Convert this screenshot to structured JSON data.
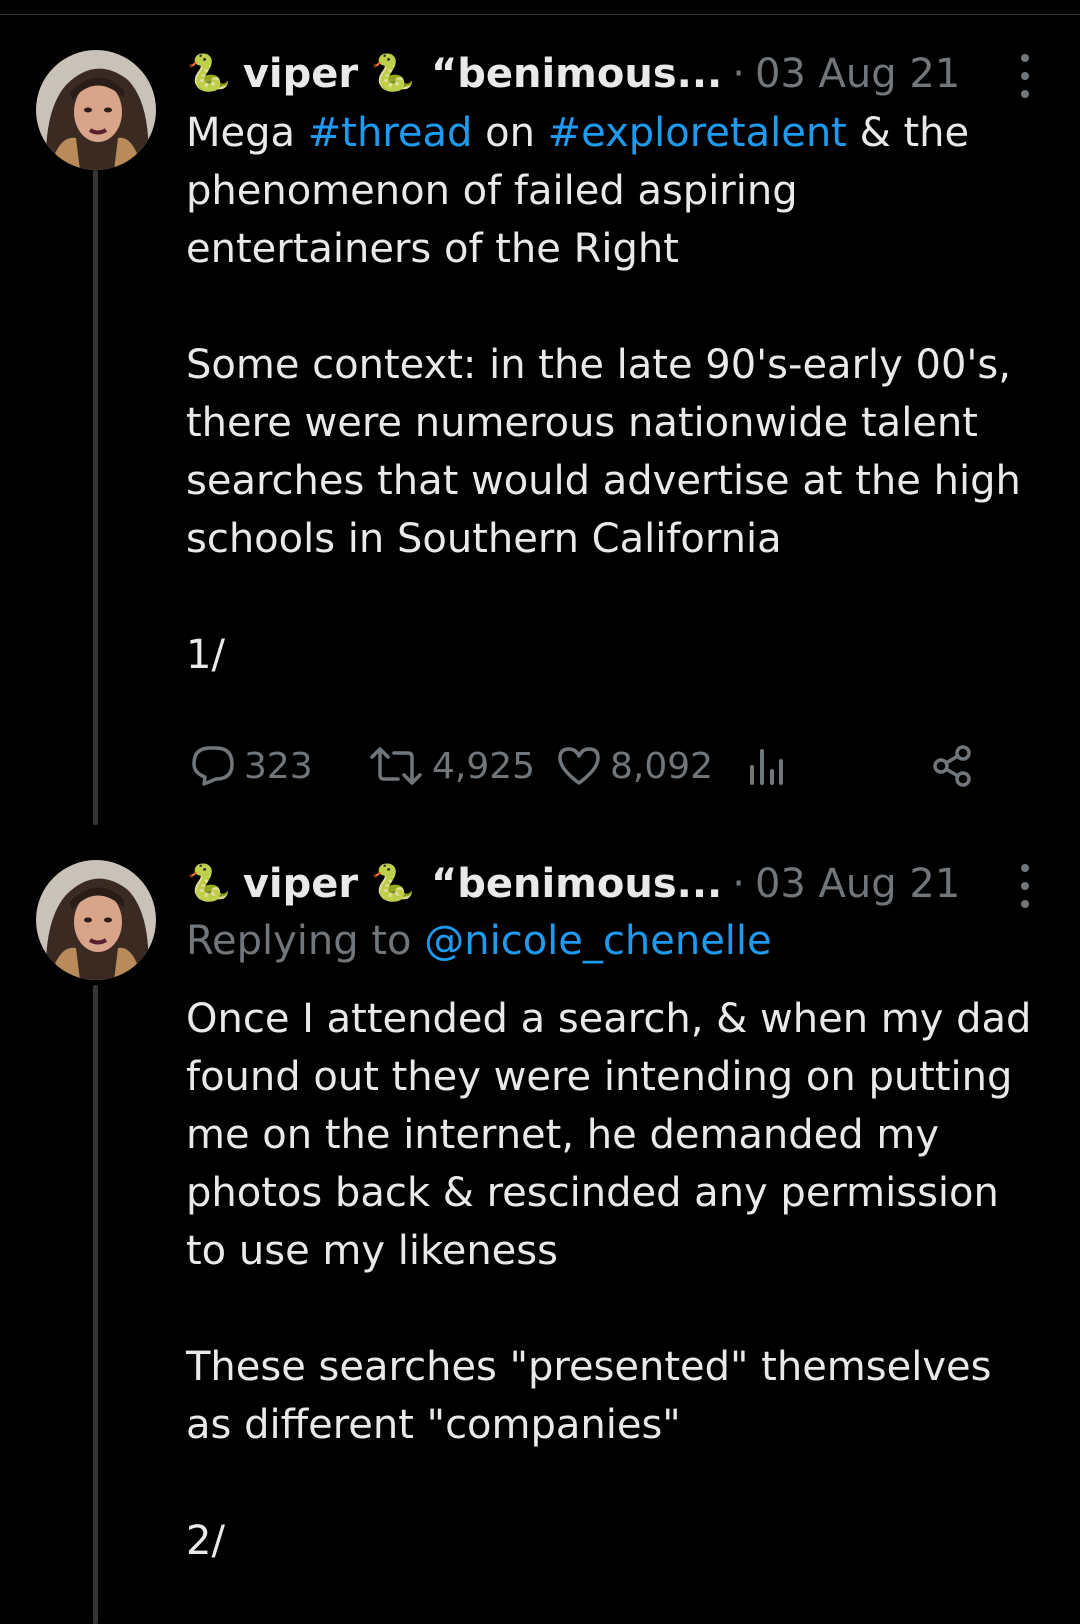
{
  "tweets": [
    {
      "author": {
        "emoji_left": "🐍",
        "name": "viper",
        "emoji_right": "🐍",
        "handle": "“benimous..."
      },
      "separator": "·",
      "date": "03 Aug 21",
      "text": {
        "l1_a": "Mega ",
        "l1_tag1": "#thread",
        "l1_b": " on ",
        "l1_tag2": "#exploretalent",
        "l1_c": " & the",
        "l2": "phenomenon of failed aspiring",
        "l3": "entertainers of the Right",
        "l4": "Some context: in the late 90's-early 00's,",
        "l5": "there were numerous nationwide talent",
        "l6": "searches that would advertise at the high",
        "l7": "schools in Southern California",
        "l8": "1/"
      },
      "stats": {
        "replies": "323",
        "retweets": "4,925",
        "likes": "8,092"
      },
      "icons": {
        "reply": "comment-icon",
        "retweet": "retweet-icon",
        "like": "heart-icon",
        "views": "analytics-icon",
        "share": "share-icon",
        "more": "more-icon"
      }
    },
    {
      "author": {
        "emoji_left": "🐍",
        "name": "viper",
        "emoji_right": "🐍",
        "handle": "“benimous..."
      },
      "separator": "·",
      "date": "03 Aug 21",
      "replying_prefix": "Replying to ",
      "replying_handle": "@nicole_chenelle",
      "text": {
        "l1": "Once I attended a search, & when my dad",
        "l2": "found out they were intending on putting",
        "l3": "me on the internet, he demanded my",
        "l4": "photos back & rescinded any permission",
        "l5": "to use my likeness",
        "l6": "These searches \"presented\" themselves",
        "l7": "as different \"companies\"",
        "l8": "2/"
      }
    }
  ],
  "colors": {
    "background": "#000000",
    "text": "#e7e9ea",
    "muted": "#71767b",
    "link": "#1d9bf0",
    "thread_line": "#333639"
  }
}
